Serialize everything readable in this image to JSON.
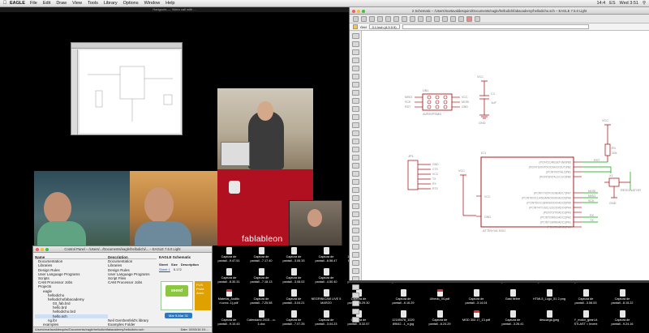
{
  "menubar": {
    "app": "EAGLE",
    "items": [
      "File",
      "Edit",
      "Draw",
      "View",
      "Tools",
      "Library",
      "Options",
      "Window",
      "Help"
    ],
    "tray": [
      "14:4",
      "ES",
      "Wed 3:51"
    ]
  },
  "video": {
    "title": "Hangouts — Video call with ...",
    "overlay_label": "fablableon"
  },
  "control_panel": {
    "title": "Control Panel – /Users/.../Documents/eagle/hellodichi/... – EAGLE 7.5.0 Light",
    "col_name": "Name",
    "col_desc": "Description",
    "tree": [
      "Documentation",
      "Libraries",
      "Design Rules",
      "User Language Programs",
      "Scripts",
      "CAM Processor Jobs",
      "Projects",
      "eagle",
      "hellodicho",
      "hellodichofabacademy",
      "03_fab.brd",
      "hello.brd",
      "hellodicho.brd",
      "hello.sch",
      "ng.lbr",
      "examples"
    ],
    "descriptions": [
      "Documentation",
      "Libraries",
      "Design Rules",
      "User Language Programs",
      "Script Files",
      "CAM Processor Jobs",
      "",
      "",
      "",
      "",
      "",
      "",
      "",
      "",
      "Neil Gershenfeld's library",
      "Examples Folder"
    ],
    "side_title": "EAGLE Schematic",
    "sheet_label": "Sheet",
    "sheet_value": "Sheet 1",
    "size_label": "Size",
    "size_value": "5.172",
    "desc_label": "Description",
    "seeed_logo": "seeed",
    "promo": "FUS Prote Anno",
    "date_button": "Mar 5-Mar 31",
    "status_path": "/Users/martavaldesquiro/Documents/eagle/hellodichifabacademy/hellodicho.sch",
    "status_date": "Date: 02/03/16 15:..."
  },
  "desktop_files": [
    {
      "name": "Captura de pantall...9.47.51",
      "type": "image"
    },
    {
      "name": "Captura de pantall...7.17.40",
      "type": "image"
    },
    {
      "name": "Captura de pantall...3.06.33",
      "type": "image"
    },
    {
      "name": "Captura de pantall...6.58.47",
      "type": "image"
    },
    {
      "name": "12670055_1020 89642...1_n.jpg",
      "type": "image"
    },
    {
      "name": "Captura de pantall...8.30.31",
      "type": "image"
    },
    {
      "name": "Captura de pantall...7.18.13",
      "type": "image"
    },
    {
      "name": "Captura de pantall...3.08.02",
      "type": "image"
    },
    {
      "name": "Captura de pantall...4.50.40",
      "type": "image"
    },
    {
      "name": "Captura de pantall...8.42.06",
      "type": "image"
    },
    {
      "name": "Material_Audito ri.conc..1).pdf",
      "type": "pdf"
    },
    {
      "name": "Captura de pantall...7.25.58",
      "type": "image"
    },
    {
      "name": "Captura de pantall...3.04.21",
      "type": "image"
    },
    {
      "name": "NEGRINICAM LIVE 5 MARZO",
      "type": "image"
    },
    {
      "name": "Captura de pantall...5.29.30",
      "type": "image"
    },
    {
      "name": "Captura de pantall...9.10.43",
      "type": "image"
    },
    {
      "name": "Calendario 2015 ...o-1.doc",
      "type": "doc"
    },
    {
      "name": "Captura de pantall...7.07.26",
      "type": "image"
    },
    {
      "name": "Captura de pantall...3.04.23",
      "type": "image"
    },
    {
      "name": "Captura de pantall...5.32.57",
      "type": "image"
    },
    {
      "name": "Captura de pantall...9.16.34",
      "type": "image"
    },
    {
      "name": "fichs.pdf",
      "type": "pdf"
    },
    {
      "name": "inventario",
      "type": "doc"
    },
    {
      "name": "Captura de pantall...8.28.32",
      "type": "image"
    },
    {
      "name": "Captura de pantall...3.07.49",
      "type": "image"
    },
    {
      "name": "Captura de pantall...6.15.19",
      "type": "image"
    },
    {
      "name": "Green CEDAO ...1.pdf",
      "type": "pdf"
    },
    {
      "name": "Captura de pantall...6.16.29",
      "type": "image"
    },
    {
      "name": "Ulbedo_04.pdf",
      "type": "pdf"
    },
    {
      "name": "Captura de pantall...3.14.04",
      "type": "image"
    },
    {
      "name": "Gast fiebre",
      "type": "doc"
    },
    {
      "name": "HTML5_Logo_51 2.png",
      "type": "image"
    },
    {
      "name": "Captura de pantall...3.58.53",
      "type": "image"
    },
    {
      "name": "Captura de pantall...8.15.22",
      "type": "image"
    },
    {
      "name": "12185478_1020 89642...1_n.jpg",
      "type": "image"
    },
    {
      "name": "Captura de pantall...6.24.29",
      "type": "image"
    },
    {
      "name": "MOD 303 17_13.pdf",
      "type": "pdf"
    },
    {
      "name": "Captura de pantall...3.26.41",
      "type": "image"
    },
    {
      "name": "descarga.jpeg",
      "type": "image"
    },
    {
      "name": "Y_motor_gearLA STLAST = Invent",
      "type": "image"
    },
    {
      "name": "Captura de pantall...9.24.16",
      "type": "image"
    },
    {
      "name": "Captura de pantall...3.59.17",
      "type": "image"
    },
    {
      "name": "Captura de pantall...8.58.18",
      "type": "image"
    },
    {
      "name": "Captura de pantall...3.51.11",
      "type": "image"
    },
    {
      "name": "fichs_coches.pdf",
      "type": "pdf"
    }
  ],
  "schematic": {
    "title": "2 Schematic – /Users/martavaldesquiro/Documents/eagle/hellodichifabacademy/hellodicho.sch – EAGLE 7.5.0 Light",
    "coord": "0.1 inch (4.9 0.9)",
    "grid_label": "Grid",
    "parts": {
      "j1": "JP1",
      "isp_ref": "U$1",
      "isp_value": "AVRISPSMD",
      "isp_pins_left": [
        "MISO",
        "SCK",
        "RST"
      ],
      "isp_pins_right": [
        "VCC",
        "MOSI",
        "GND"
      ],
      "cap_ref": "C1",
      "cap_val": "1uF",
      "r_ref": "R1",
      "r_val": "10k",
      "u1_ref": "IC1",
      "u1_value": "ATTINY44-SSU",
      "u1_left": [
        "VCC",
        "GND"
      ],
      "u1_right": [
        "(PCINT11/RESET/dW)PB3",
        "(PCINT10/INT0/OC0A/CKOUT)PB2",
        "(PCINT9/XTAL2)PB1",
        "(PCINT8/XTAL1/CLKI)PB0",
        "(PCINT7/ICP/OC0B/ADC7)PA7",
        "(PCINT6/OC1A/SDA/MOSI/DI/ADC6)PA6",
        "(PCINT5/OC1B/MISO/DO/ADC5)PA5",
        "(PCINT4/T1/SCL/USCK/ADC4)PA4",
        "(PCINT3/T0/ADC3)PA3",
        "(PCINT2/AIN1/ADC2)PA2",
        "(PCINT1/AIN0/ADC1)PA1",
        "(PCINT0/ADC0)PA0"
      ],
      "net_labels": [
        "RST",
        "MOSI",
        "MISO",
        "SCK",
        "RX",
        "TX"
      ],
      "ftdi_pins": [
        "GND",
        "CTS",
        "VCC",
        "TX",
        "RX",
        "RTS"
      ],
      "resonator": "RESONATOR",
      "x_ref": "X1",
      "vcc": "VCC",
      "gnd": "GND"
    }
  },
  "colors": {
    "schematic_part": "#a00000",
    "schematic_net": "#00a000",
    "schematic_text": "#a0a0a0",
    "logo_red": "#b0101f"
  }
}
